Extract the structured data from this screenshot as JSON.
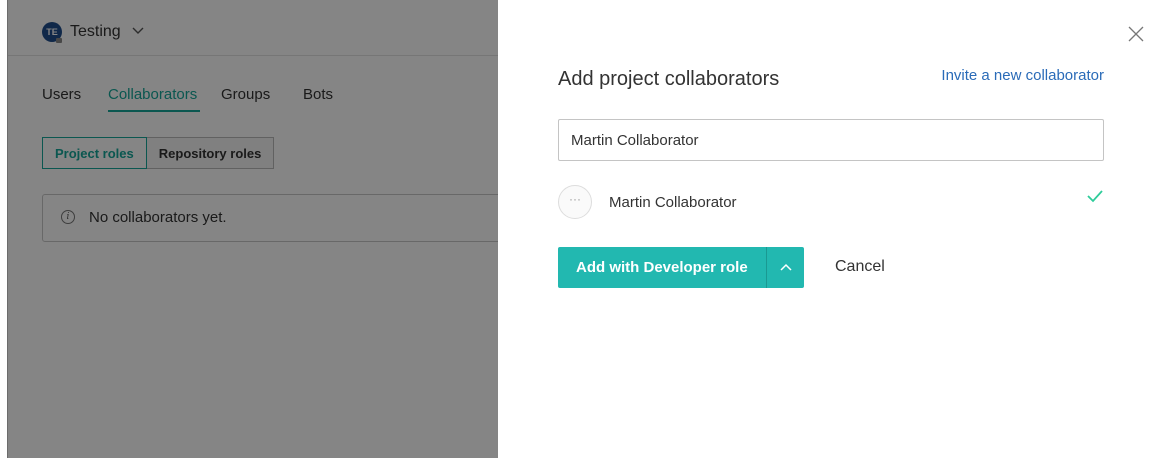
{
  "background": {
    "project": {
      "avatar_initials": "TE",
      "name": "Testing"
    },
    "tabs": [
      {
        "label": "Users"
      },
      {
        "label": "Collaborators"
      },
      {
        "label": "Groups"
      },
      {
        "label": "Bots"
      }
    ],
    "active_tab": "Collaborators",
    "role_toggle": {
      "project_roles": "Project roles",
      "repository_roles": "Repository roles"
    },
    "empty_message": "No collaborators yet."
  },
  "panel": {
    "title": "Add project collaborators",
    "invite_link": "Invite a new collaborator",
    "search": {
      "value": "Martin Collaborator",
      "placeholder": ""
    },
    "result": {
      "avatar_text": "···",
      "name": "Martin Collaborator",
      "selected": true
    },
    "add_button_label": "Add with Developer role",
    "cancel_label": "Cancel"
  },
  "colors": {
    "accent": "#22b8b0",
    "tab_active": "#16a79a",
    "link": "#2a6bb8",
    "check": "#2ecc9a"
  },
  "icons": [
    "chevron-down-icon",
    "info-icon",
    "close-icon",
    "checkmark-icon",
    "chevron-up-icon"
  ]
}
